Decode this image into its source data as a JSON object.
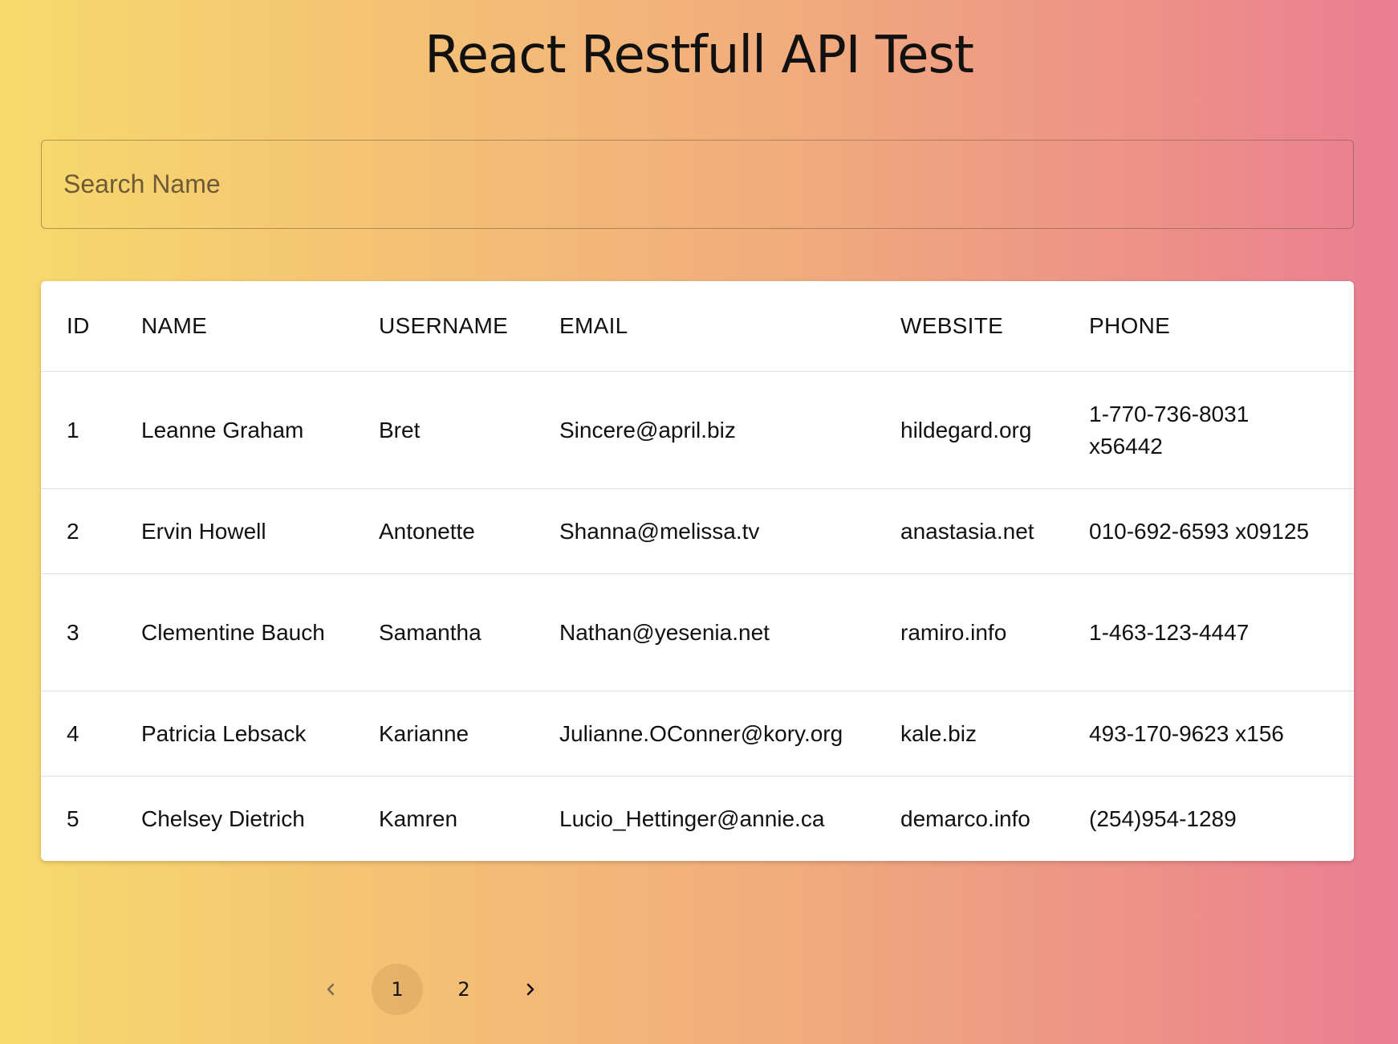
{
  "header": {
    "title": "React Restfull API Test"
  },
  "search": {
    "placeholder": "Search Name",
    "value": ""
  },
  "table": {
    "columns": [
      "ID",
      "NAME",
      "USERNAME",
      "EMAIL",
      "WEBSITE",
      "PHONE"
    ],
    "rows": [
      {
        "id": "1",
        "name": "Leanne Graham",
        "username": "Bret",
        "email": "Sincere@april.biz",
        "website": "hildegard.org",
        "phone": "1-770-736-8031 x56442"
      },
      {
        "id": "2",
        "name": "Ervin Howell",
        "username": "Antonette",
        "email": "Shanna@melissa.tv",
        "website": "anastasia.net",
        "phone": "010-692-6593 x09125"
      },
      {
        "id": "3",
        "name": "Clementine Bauch",
        "username": "Samantha",
        "email": "Nathan@yesenia.net",
        "website": "ramiro.info",
        "phone": "1-463-123-4447"
      },
      {
        "id": "4",
        "name": "Patricia Lebsack",
        "username": "Karianne",
        "email": "Julianne.OConner@kory.org",
        "website": "kale.biz",
        "phone": "493-170-9623 x156"
      },
      {
        "id": "5",
        "name": "Chelsey Dietrich",
        "username": "Kamren",
        "email": "Lucio_Hettinger@annie.ca",
        "website": "demarco.info",
        "phone": "(254)954-1289"
      }
    ]
  },
  "pagination": {
    "pages": [
      "1",
      "2"
    ],
    "current_page": "1",
    "prev_icon": "chevron-left-icon",
    "next_icon": "chevron-right-icon"
  },
  "colors": {
    "gradient_start": "#f8da6c",
    "gradient_end": "#ea7e92",
    "card_background": "#ffffff"
  }
}
